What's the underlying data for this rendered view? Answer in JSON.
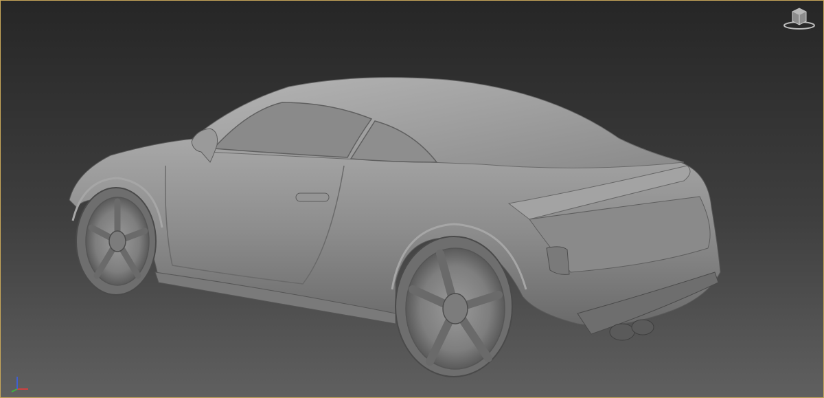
{
  "viewport": {
    "render_mode": "default-shading",
    "background_top": "#2a2a2a",
    "background_bottom": "#5c5c5c",
    "active_border": "#c9a85a",
    "model_color": "#8f8f8f"
  },
  "scene": {
    "model": "sports-coupe",
    "parts": [
      "body",
      "roof",
      "rear-window",
      "side-window",
      "side-mirror",
      "door-handle",
      "spoiler",
      "tail-light",
      "rear-diffuser",
      "exhaust-tips",
      "front-wheel",
      "rear-wheel"
    ]
  },
  "gizmos": {
    "viewcube_icon": "viewcube-icon",
    "axis_icon": "axis-tripod-icon",
    "axis_colors": {
      "x": "#d04040",
      "y": "#40b040",
      "z": "#4060d0"
    }
  }
}
